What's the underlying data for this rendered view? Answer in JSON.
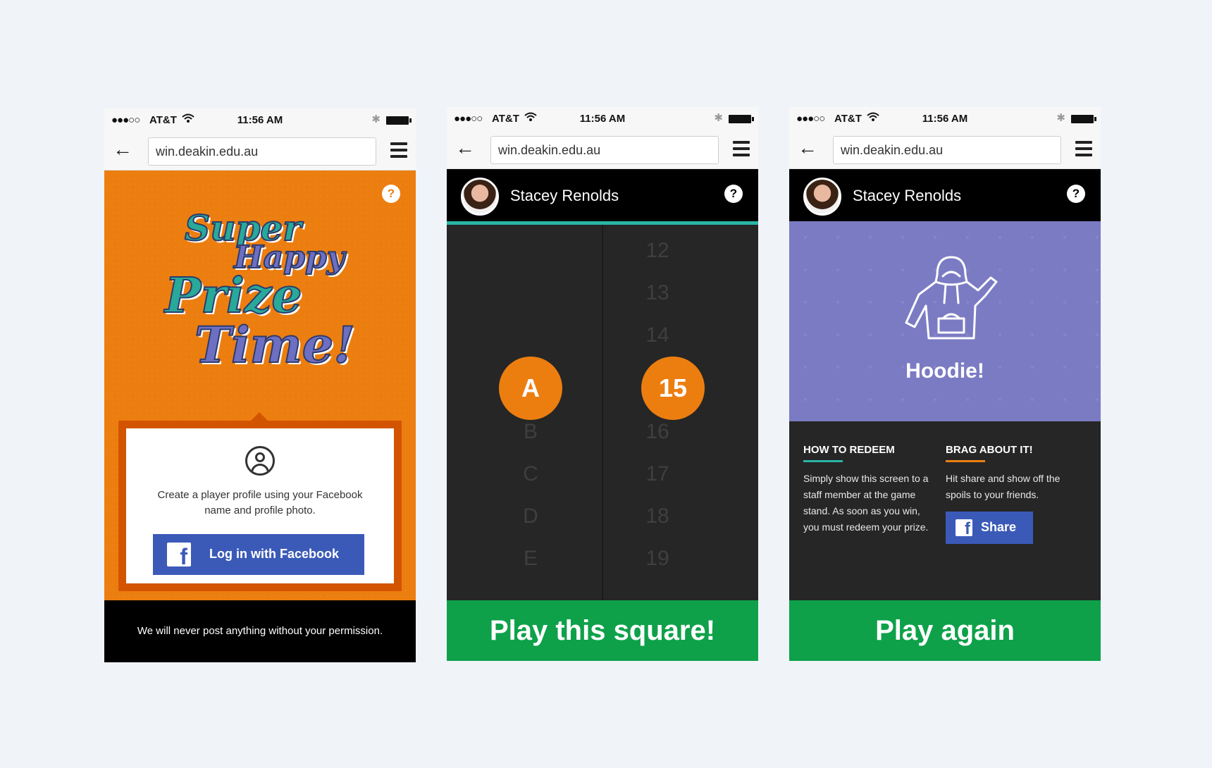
{
  "status_bar": {
    "signal": "●●●○○",
    "carrier": "AT&T",
    "time": "11:56 AM"
  },
  "browser": {
    "url": "win.deakin.edu.au"
  },
  "screen1": {
    "help": "?",
    "logo_lines": [
      "Super",
      "Happy",
      "Prize",
      "Time!"
    ],
    "card_text": "Create a player profile using your Facebook name and profile photo.",
    "login_button": "Log in with Facebook",
    "facebook_glyph": "f",
    "footer": "We will never post anything without your permission."
  },
  "screen2": {
    "username": "Stacey Renolds",
    "help": "?",
    "letters": [
      "A",
      "B",
      "C",
      "D",
      "E"
    ],
    "numbers": [
      "12",
      "13",
      "14",
      "15",
      "16",
      "17",
      "18",
      "19"
    ],
    "selected_letter": "A",
    "selected_number": "15",
    "play_button": "Play this square!"
  },
  "screen3": {
    "username": "Stacey Renolds",
    "help": "?",
    "prize": "Hoodie!",
    "redeem_title": "HOW TO REDEEM",
    "redeem_text": "Simply show this screen to a staff member at the game stand. As soon as you win, you must redeem your prize.",
    "brag_title": "BRAG ABOUT IT!",
    "brag_text": "Hit share and show off the spoils to your friends.",
    "share_button": "Share",
    "facebook_glyph": "f",
    "play_again_button": "Play again"
  },
  "colors": {
    "orange": "#ec7e10",
    "teal": "#2bb5a5",
    "purple": "#7b7bc4",
    "green": "#0ea14a",
    "facebook_blue": "#3b5ab8"
  }
}
